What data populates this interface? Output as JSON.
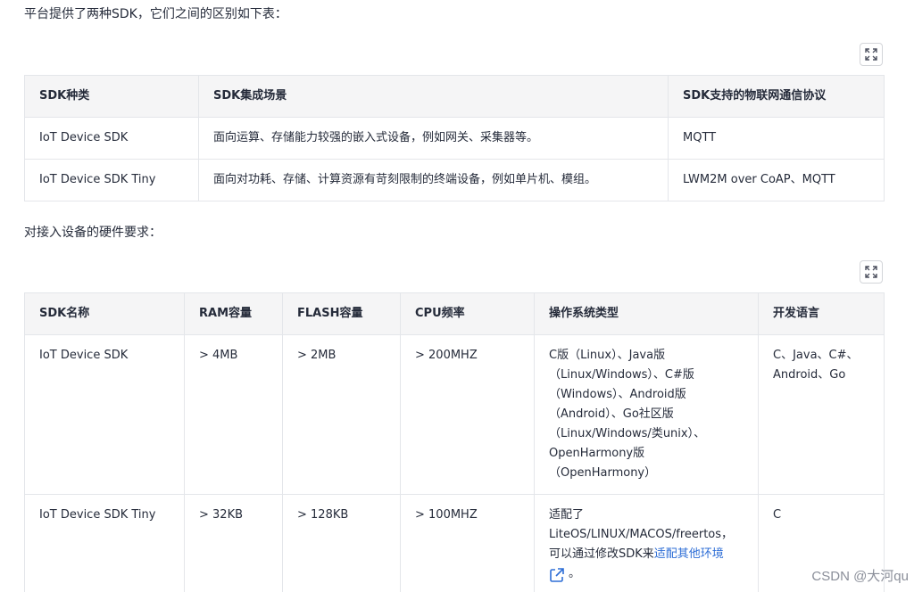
{
  "intro_text": "平台提供了两种SDK，它们之间的区别如下表：",
  "hardware_text": "对接入设备的硬件要求：",
  "table1": {
    "headers": [
      "SDK种类",
      "SDK集成场景",
      "SDK支持的物联网通信协议"
    ],
    "rows": [
      [
        "IoT Device SDK",
        "面向运算、存储能力较强的嵌入式设备，例如网关、采集器等。",
        "MQTT"
      ],
      [
        "IoT Device SDK Tiny",
        "面向对功耗、存储、计算资源有苛刻限制的终端设备，例如单片机、模组。",
        "LWM2M over CoAP、MQTT"
      ]
    ]
  },
  "table2": {
    "headers": [
      "SDK名称",
      "RAM容量",
      "FLASH容量",
      "CPU频率",
      "操作系统类型",
      "开发语言"
    ],
    "row1": {
      "name": "IoT Device SDK",
      "ram": "> 4MB",
      "flash": "> 2MB",
      "cpu": "> 200MHZ",
      "os_lines": [
        "C版（Linux）、Java版",
        "（Linux/Windows）、C#版",
        "（Windows）、Android版",
        "（Android）、Go社区版",
        "（Linux/Windows/类unix）、",
        "OpenHarmony版",
        "（OpenHarmony）"
      ],
      "lang_lines": [
        "C、Java、C#、",
        "Android、Go"
      ]
    },
    "row2": {
      "name": "IoT Device SDK Tiny",
      "ram": "> 32KB",
      "flash": "> 128KB",
      "cpu": "> 100MHZ",
      "os_line1": "适配了",
      "os_line2": "LiteOS/LINUX/MACOS/freertos，",
      "os_line3_prefix": "可以通过修改SDK来",
      "os_line3_link": "适配其他环境",
      "os_line4_suffix": "。",
      "lang": "C"
    }
  },
  "icons": {
    "expand": "expand-icon",
    "external_link": "external-link-icon"
  },
  "colors": {
    "header_bg": "#f5f5f6",
    "border": "#e4e6ea",
    "link": "#2e6ed6",
    "text": "#252b3a"
  },
  "watermark": "CSDN @大河qu"
}
